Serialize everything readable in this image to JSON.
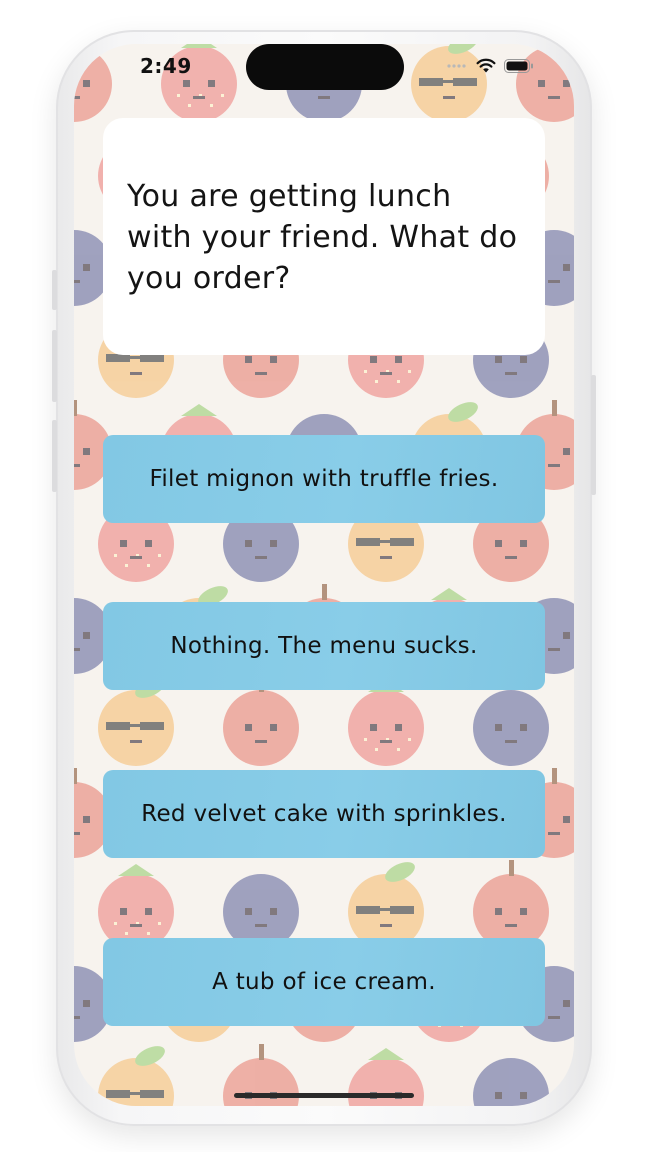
{
  "status_bar": {
    "time": "2:49",
    "icons": [
      "signal-icon",
      "wifi-icon",
      "battery-icon"
    ]
  },
  "question": {
    "text": "You are getting lunch with your friend. What do you order?"
  },
  "answers": [
    {
      "label": "Filet mignon with truffle fries."
    },
    {
      "label": "Nothing. The menu sucks."
    },
    {
      "label": "Red velvet cake with sprinkles."
    },
    {
      "label": "A tub of ice cream."
    }
  ],
  "colors": {
    "background": "#f7f3ee",
    "card": "#ffffff",
    "answer_button": "#86cbe6",
    "apple": "#e8867a",
    "strawberry": "#ee8a86",
    "blueberry": "#6a6fa2",
    "orange": "#f6c07a",
    "leaf": "#9ccf78"
  },
  "background_pattern": {
    "fruits": [
      "apple-icon",
      "strawberry-icon",
      "blueberry-icon",
      "orange-icon"
    ]
  }
}
